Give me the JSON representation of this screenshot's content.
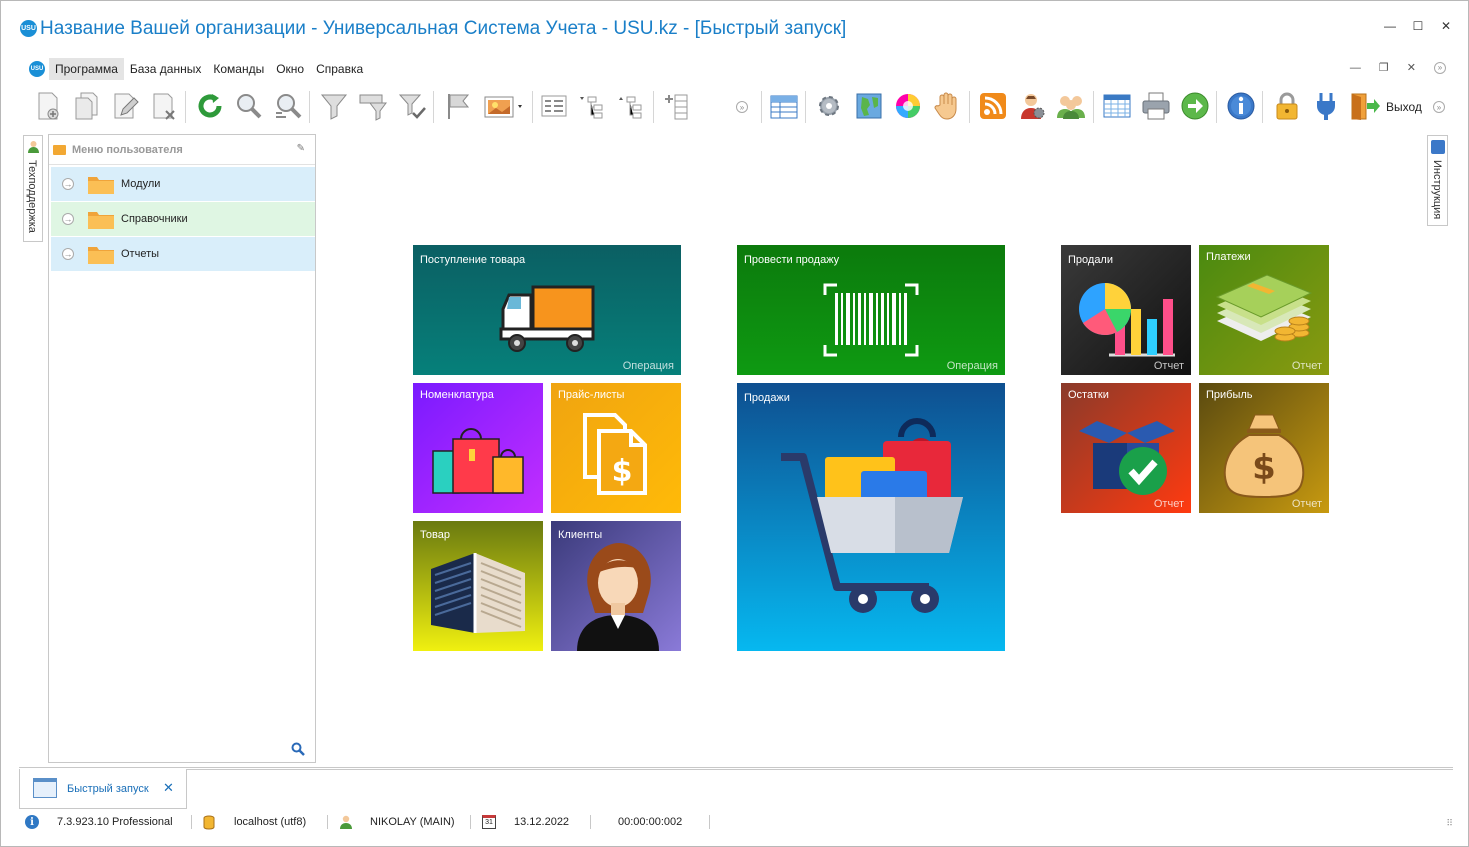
{
  "window": {
    "title": "Название Вашей организации - Универсальная Система Учета - USU.kz - [Быстрый запуск]",
    "logo_text": "USU",
    "controls": [
      "—",
      "☐",
      "✕"
    ]
  },
  "menu": {
    "items": [
      "Программа",
      "База данных",
      "Команды",
      "Окно",
      "Справка"
    ]
  },
  "toolbar": {
    "exit_label": "Выход"
  },
  "side_tabs": {
    "left": "Техподдержка",
    "right": "Инструкция"
  },
  "user_panel": {
    "title": "Меню пользователя",
    "items": [
      {
        "label": "Модули",
        "bg": "#d9eefa"
      },
      {
        "label": "Справочники",
        "bg": "#dff6e3"
      },
      {
        "label": "Отчеты",
        "bg": "#d9eefa"
      }
    ]
  },
  "tiles": {
    "receipt": {
      "title": "Поступление товара",
      "type": "Операция"
    },
    "sale": {
      "title": "Провести продажу",
      "type": "Операция"
    },
    "sold": {
      "title": "Продали",
      "type": "Отчет"
    },
    "payments": {
      "title": "Платежи",
      "type": "Отчет"
    },
    "nomenclature": {
      "title": "Номенклатура"
    },
    "pricelists": {
      "title": "Прайс-листы"
    },
    "sales": {
      "title": "Продажи"
    },
    "stock": {
      "title": "Остатки",
      "type": "Отчет"
    },
    "profit": {
      "title": "Прибыль",
      "type": "Отчет"
    },
    "goods": {
      "title": "Товар"
    },
    "clients": {
      "title": "Клиенты"
    }
  },
  "doc_tab": {
    "label": "Быстрый запуск",
    "close": "✕"
  },
  "status": {
    "version": "7.3.923.10 Professional",
    "db": "localhost (utf8)",
    "user": "NIKOLAY (MAIN)",
    "calendar_day": "31",
    "date": "13.12.2022",
    "timer": "00:00:00:002"
  }
}
